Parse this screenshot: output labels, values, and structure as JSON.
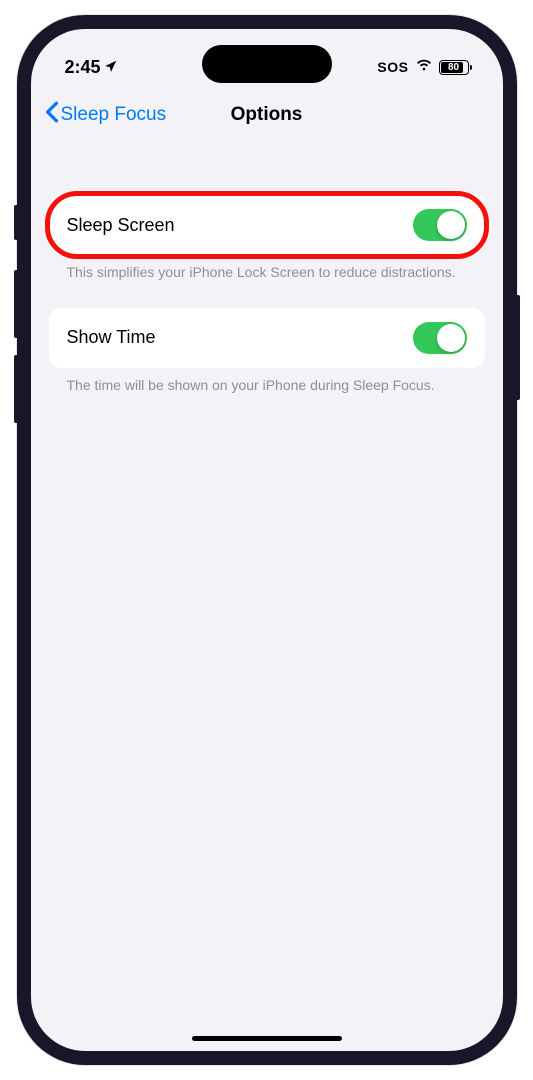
{
  "statusBar": {
    "time": "2:45",
    "sos": "SOS",
    "battery": "80"
  },
  "nav": {
    "back": "Sleep Focus",
    "title": "Options"
  },
  "settings": {
    "sleepScreen": {
      "label": "Sleep Screen",
      "footer": "This simplifies your iPhone Lock Screen to reduce distractions."
    },
    "showTime": {
      "label": "Show Time",
      "footer": "The time will be shown on your iPhone during Sleep Focus."
    }
  }
}
